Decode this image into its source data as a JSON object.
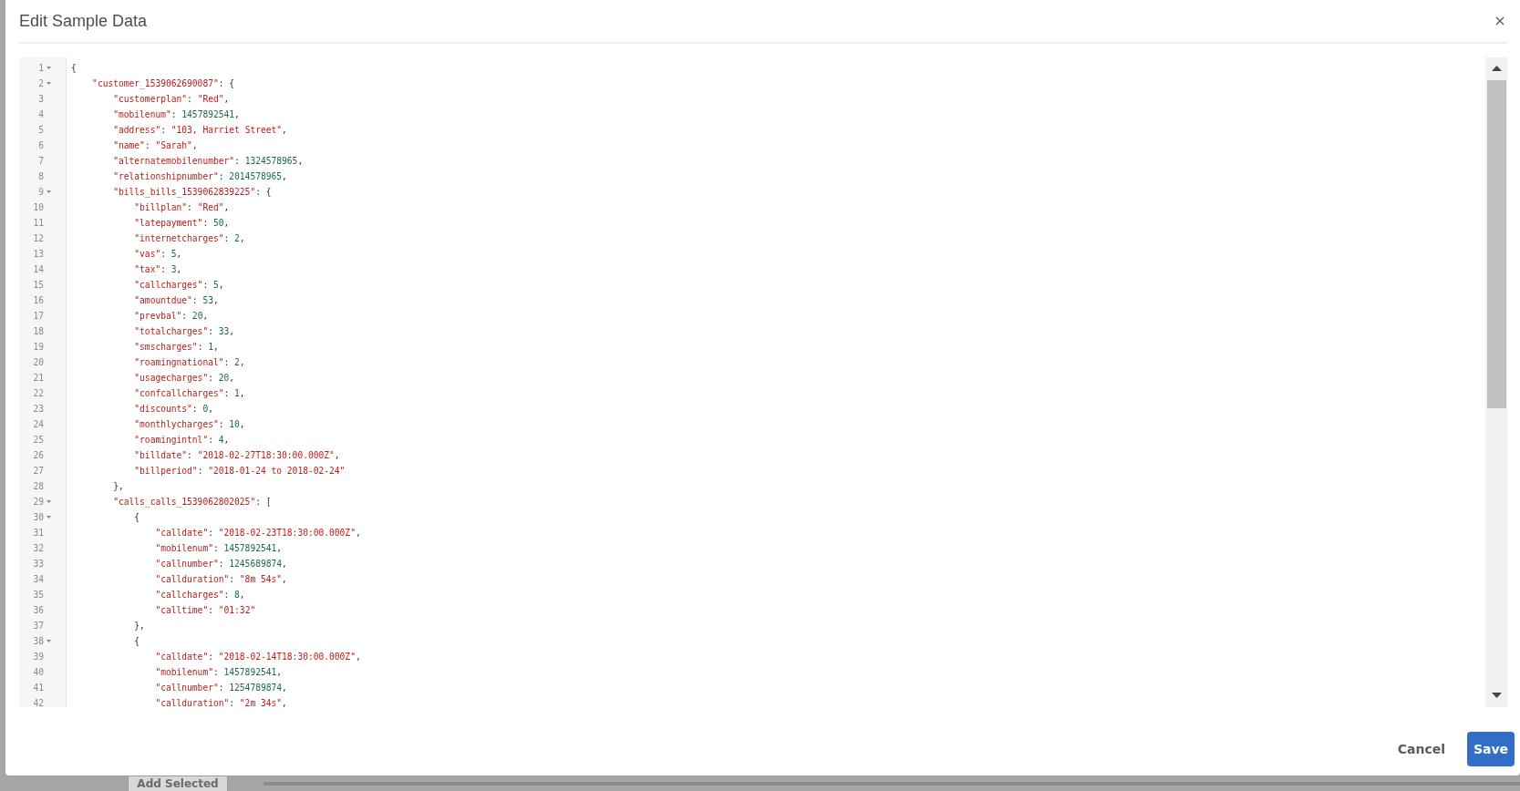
{
  "background": {
    "button": "Add Selected"
  },
  "dialog": {
    "title": "Edit Sample Data",
    "editor": {
      "lines": [
        {
          "number": "1",
          "foldable": true,
          "tokens": [
            {
              "kind": "punct",
              "text": "{"
            }
          ]
        },
        {
          "number": "2",
          "foldable": true,
          "tokens": [
            {
              "kind": "key",
              "text": "    \"customer_1539062690087\""
            },
            {
              "kind": "punct",
              "text": ": {"
            }
          ]
        },
        {
          "number": "3",
          "foldable": false,
          "tokens": [
            {
              "kind": "key",
              "text": "        \"customerplan\""
            },
            {
              "kind": "punct",
              "text": ": "
            },
            {
              "kind": "string",
              "text": "\"Red\""
            },
            {
              "kind": "punct",
              "text": ","
            }
          ]
        },
        {
          "number": "4",
          "foldable": false,
          "tokens": [
            {
              "kind": "key",
              "text": "        \"mobilenum\""
            },
            {
              "kind": "punct",
              "text": ": "
            },
            {
              "kind": "number",
              "text": "1457892541"
            },
            {
              "kind": "punct",
              "text": ","
            }
          ]
        },
        {
          "number": "5",
          "foldable": false,
          "tokens": [
            {
              "kind": "key",
              "text": "        \"address\""
            },
            {
              "kind": "punct",
              "text": ": "
            },
            {
              "kind": "string",
              "text": "\"103, Harriet Street\""
            },
            {
              "kind": "punct",
              "text": ","
            }
          ]
        },
        {
          "number": "6",
          "foldable": false,
          "tokens": [
            {
              "kind": "key",
              "text": "        \"name\""
            },
            {
              "kind": "punct",
              "text": ": "
            },
            {
              "kind": "string",
              "text": "\"Sarah\""
            },
            {
              "kind": "punct",
              "text": ","
            }
          ]
        },
        {
          "number": "7",
          "foldable": false,
          "tokens": [
            {
              "kind": "key",
              "text": "        \"alternatemobilenumber\""
            },
            {
              "kind": "punct",
              "text": ": "
            },
            {
              "kind": "number",
              "text": "1324578965"
            },
            {
              "kind": "punct",
              "text": ","
            }
          ]
        },
        {
          "number": "8",
          "foldable": false,
          "tokens": [
            {
              "kind": "key",
              "text": "        \"relationshipnumber\""
            },
            {
              "kind": "punct",
              "text": ": "
            },
            {
              "kind": "number",
              "text": "2014578965"
            },
            {
              "kind": "punct",
              "text": ","
            }
          ]
        },
        {
          "number": "9",
          "foldable": true,
          "tokens": [
            {
              "kind": "key",
              "text": "        \"bills_bills_1539062839225\""
            },
            {
              "kind": "punct",
              "text": ": {"
            }
          ]
        },
        {
          "number": "10",
          "foldable": false,
          "tokens": [
            {
              "kind": "key",
              "text": "            \"billplan\""
            },
            {
              "kind": "punct",
              "text": ": "
            },
            {
              "kind": "string",
              "text": "\"Red\""
            },
            {
              "kind": "punct",
              "text": ","
            }
          ]
        },
        {
          "number": "11",
          "foldable": false,
          "tokens": [
            {
              "kind": "key",
              "text": "            \"latepayment\""
            },
            {
              "kind": "punct",
              "text": ": "
            },
            {
              "kind": "number",
              "text": "50"
            },
            {
              "kind": "punct",
              "text": ","
            }
          ]
        },
        {
          "number": "12",
          "foldable": false,
          "tokens": [
            {
              "kind": "key",
              "text": "            \"internetcharges\""
            },
            {
              "kind": "punct",
              "text": ": "
            },
            {
              "kind": "number",
              "text": "2"
            },
            {
              "kind": "punct",
              "text": ","
            }
          ]
        },
        {
          "number": "13",
          "foldable": false,
          "tokens": [
            {
              "kind": "key",
              "text": "            \"vas\""
            },
            {
              "kind": "punct",
              "text": ": "
            },
            {
              "kind": "number",
              "text": "5"
            },
            {
              "kind": "punct",
              "text": ","
            }
          ]
        },
        {
          "number": "14",
          "foldable": false,
          "tokens": [
            {
              "kind": "key",
              "text": "            \"tax\""
            },
            {
              "kind": "punct",
              "text": ": "
            },
            {
              "kind": "number",
              "text": "3"
            },
            {
              "kind": "punct",
              "text": ","
            }
          ]
        },
        {
          "number": "15",
          "foldable": false,
          "tokens": [
            {
              "kind": "key",
              "text": "            \"callcharges\""
            },
            {
              "kind": "punct",
              "text": ": "
            },
            {
              "kind": "number",
              "text": "5"
            },
            {
              "kind": "punct",
              "text": ","
            }
          ]
        },
        {
          "number": "16",
          "foldable": false,
          "tokens": [
            {
              "kind": "key",
              "text": "            \"amountdue\""
            },
            {
              "kind": "punct",
              "text": ": "
            },
            {
              "kind": "number",
              "text": "53"
            },
            {
              "kind": "punct",
              "text": ","
            }
          ]
        },
        {
          "number": "17",
          "foldable": false,
          "tokens": [
            {
              "kind": "key",
              "text": "            \"prevbal\""
            },
            {
              "kind": "punct",
              "text": ": "
            },
            {
              "kind": "number",
              "text": "20"
            },
            {
              "kind": "punct",
              "text": ","
            }
          ]
        },
        {
          "number": "18",
          "foldable": false,
          "tokens": [
            {
              "kind": "key",
              "text": "            \"totalcharges\""
            },
            {
              "kind": "punct",
              "text": ": "
            },
            {
              "kind": "number",
              "text": "33"
            },
            {
              "kind": "punct",
              "text": ","
            }
          ]
        },
        {
          "number": "19",
          "foldable": false,
          "tokens": [
            {
              "kind": "key",
              "text": "            \"smscharges\""
            },
            {
              "kind": "punct",
              "text": ": "
            },
            {
              "kind": "number",
              "text": "1"
            },
            {
              "kind": "punct",
              "text": ","
            }
          ]
        },
        {
          "number": "20",
          "foldable": false,
          "tokens": [
            {
              "kind": "key",
              "text": "            \"roamingnational\""
            },
            {
              "kind": "punct",
              "text": ": "
            },
            {
              "kind": "number",
              "text": "2"
            },
            {
              "kind": "punct",
              "text": ","
            }
          ]
        },
        {
          "number": "21",
          "foldable": false,
          "tokens": [
            {
              "kind": "key",
              "text": "            \"usagecharges\""
            },
            {
              "kind": "punct",
              "text": ": "
            },
            {
              "kind": "number",
              "text": "20"
            },
            {
              "kind": "punct",
              "text": ","
            }
          ]
        },
        {
          "number": "22",
          "foldable": false,
          "tokens": [
            {
              "kind": "key",
              "text": "            \"confcallcharges\""
            },
            {
              "kind": "punct",
              "text": ": "
            },
            {
              "kind": "number",
              "text": "1"
            },
            {
              "kind": "punct",
              "text": ","
            }
          ]
        },
        {
          "number": "23",
          "foldable": false,
          "tokens": [
            {
              "kind": "key",
              "text": "            \"discounts\""
            },
            {
              "kind": "punct",
              "text": ": "
            },
            {
              "kind": "number",
              "text": "0"
            },
            {
              "kind": "punct",
              "text": ","
            }
          ]
        },
        {
          "number": "24",
          "foldable": false,
          "tokens": [
            {
              "kind": "key",
              "text": "            \"monthlycharges\""
            },
            {
              "kind": "punct",
              "text": ": "
            },
            {
              "kind": "number",
              "text": "10"
            },
            {
              "kind": "punct",
              "text": ","
            }
          ]
        },
        {
          "number": "25",
          "foldable": false,
          "tokens": [
            {
              "kind": "key",
              "text": "            \"roamingintnl\""
            },
            {
              "kind": "punct",
              "text": ": "
            },
            {
              "kind": "number",
              "text": "4"
            },
            {
              "kind": "punct",
              "text": ","
            }
          ]
        },
        {
          "number": "26",
          "foldable": false,
          "tokens": [
            {
              "kind": "key",
              "text": "            \"billdate\""
            },
            {
              "kind": "punct",
              "text": ": "
            },
            {
              "kind": "string",
              "text": "\"2018-02-27T18:30:00.000Z\""
            },
            {
              "kind": "punct",
              "text": ","
            }
          ]
        },
        {
          "number": "27",
          "foldable": false,
          "tokens": [
            {
              "kind": "key",
              "text": "            \"billperiod\""
            },
            {
              "kind": "punct",
              "text": ": "
            },
            {
              "kind": "string",
              "text": "\"2018-01-24 to 2018-02-24\""
            }
          ]
        },
        {
          "number": "28",
          "foldable": false,
          "tokens": [
            {
              "kind": "punct",
              "text": "        },"
            }
          ]
        },
        {
          "number": "29",
          "foldable": true,
          "tokens": [
            {
              "kind": "key",
              "text": "        \"calls_calls_1539062802025\""
            },
            {
              "kind": "punct",
              "text": ": ["
            }
          ]
        },
        {
          "number": "30",
          "foldable": true,
          "tokens": [
            {
              "kind": "punct",
              "text": "            {"
            }
          ]
        },
        {
          "number": "31",
          "foldable": false,
          "tokens": [
            {
              "kind": "key",
              "text": "                \"calldate\""
            },
            {
              "kind": "punct",
              "text": ": "
            },
            {
              "kind": "string",
              "text": "\"2018-02-23T18:30:00.000Z\""
            },
            {
              "kind": "punct",
              "text": ","
            }
          ]
        },
        {
          "number": "32",
          "foldable": false,
          "tokens": [
            {
              "kind": "key",
              "text": "                \"mobilenum\""
            },
            {
              "kind": "punct",
              "text": ": "
            },
            {
              "kind": "number",
              "text": "1457892541"
            },
            {
              "kind": "punct",
              "text": ","
            }
          ]
        },
        {
          "number": "33",
          "foldable": false,
          "tokens": [
            {
              "kind": "key",
              "text": "                \"callnumber\""
            },
            {
              "kind": "punct",
              "text": ": "
            },
            {
              "kind": "number",
              "text": "1245689874"
            },
            {
              "kind": "punct",
              "text": ","
            }
          ]
        },
        {
          "number": "34",
          "foldable": false,
          "tokens": [
            {
              "kind": "key",
              "text": "                \"callduration\""
            },
            {
              "kind": "punct",
              "text": ": "
            },
            {
              "kind": "string",
              "text": "\"8m 54s\""
            },
            {
              "kind": "punct",
              "text": ","
            }
          ]
        },
        {
          "number": "35",
          "foldable": false,
          "tokens": [
            {
              "kind": "key",
              "text": "                \"callcharges\""
            },
            {
              "kind": "punct",
              "text": ": "
            },
            {
              "kind": "number",
              "text": "8"
            },
            {
              "kind": "punct",
              "text": ","
            }
          ]
        },
        {
          "number": "36",
          "foldable": false,
          "tokens": [
            {
              "kind": "key",
              "text": "                \"calltime\""
            },
            {
              "kind": "punct",
              "text": ": "
            },
            {
              "kind": "string",
              "text": "\"01:32\""
            }
          ]
        },
        {
          "number": "37",
          "foldable": false,
          "tokens": [
            {
              "kind": "punct",
              "text": "            },"
            }
          ]
        },
        {
          "number": "38",
          "foldable": true,
          "tokens": [
            {
              "kind": "punct",
              "text": "            {"
            }
          ]
        },
        {
          "number": "39",
          "foldable": false,
          "tokens": [
            {
              "kind": "key",
              "text": "                \"calldate\""
            },
            {
              "kind": "punct",
              "text": ": "
            },
            {
              "kind": "string",
              "text": "\"2018-02-14T18:30:00.000Z\""
            },
            {
              "kind": "punct",
              "text": ","
            }
          ]
        },
        {
          "number": "40",
          "foldable": false,
          "tokens": [
            {
              "kind": "key",
              "text": "                \"mobilenum\""
            },
            {
              "kind": "punct",
              "text": ": "
            },
            {
              "kind": "number",
              "text": "1457892541"
            },
            {
              "kind": "punct",
              "text": ","
            }
          ]
        },
        {
          "number": "41",
          "foldable": false,
          "tokens": [
            {
              "kind": "key",
              "text": "                \"callnumber\""
            },
            {
              "kind": "punct",
              "text": ": "
            },
            {
              "kind": "number",
              "text": "1254789874"
            },
            {
              "kind": "punct",
              "text": ","
            }
          ]
        },
        {
          "number": "42",
          "foldable": false,
          "tokens": [
            {
              "kind": "key",
              "text": "                \"callduration\""
            },
            {
              "kind": "punct",
              "text": ": "
            },
            {
              "kind": "string",
              "text": "\"2m 34s\""
            },
            {
              "kind": "punct",
              "text": ","
            }
          ]
        }
      ]
    },
    "buttons": [
      {
        "label": "Cancel",
        "kind": "secondary"
      },
      {
        "label": "Save",
        "kind": "primary"
      }
    ]
  }
}
